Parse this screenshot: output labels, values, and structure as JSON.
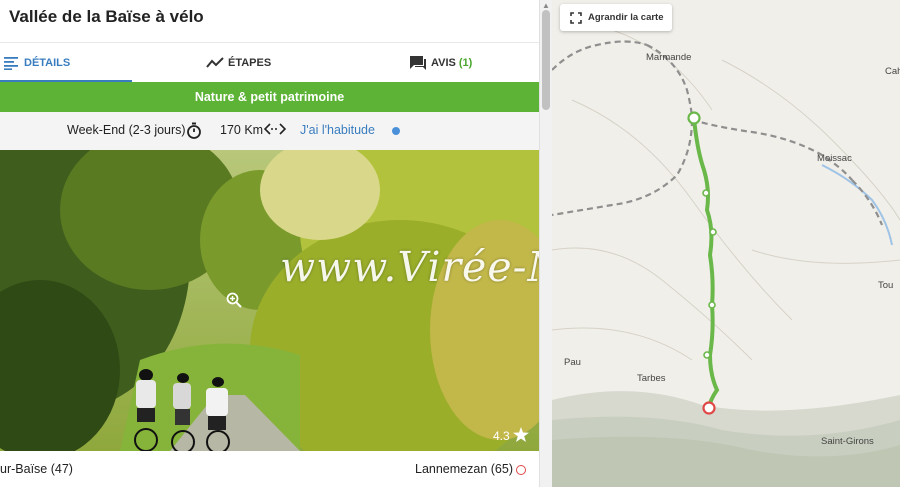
{
  "title": "Vallée de la Baïse à vélo",
  "tabs": [
    {
      "label": "DÉTAILS",
      "icon": "list-icon",
      "active": true
    },
    {
      "label": "ÉTAPES",
      "icon": "trend-line-icon"
    },
    {
      "label": "AVIS",
      "icon": "comments-icon",
      "count": "(1)"
    }
  ],
  "banner": "Nature & petit patrimoine",
  "info": {
    "duration_label": "Week-End",
    "duration_detail": "(2-3 jours)",
    "distance": "170 Km",
    "level": "J'ai l'habitude",
    "level_color": "#4a90d9"
  },
  "photo": {
    "watermark": "www.Virée-Malin.fr",
    "rating": "4.3"
  },
  "endpoints": {
    "start": "ur-Baïse (47)",
    "end": "Lannemezan (65)"
  },
  "map": {
    "enlarge_label": "Agrandir la carte",
    "towns": [
      "Marmande",
      "Cah",
      "Moissac",
      "Tou",
      "Pau",
      "Tarbes",
      "Saint-Girons"
    ]
  },
  "colors": {
    "accent": "#3a7dbf",
    "banner": "#5cb335",
    "route": "#6ab84a",
    "end_marker": "#e04848"
  }
}
